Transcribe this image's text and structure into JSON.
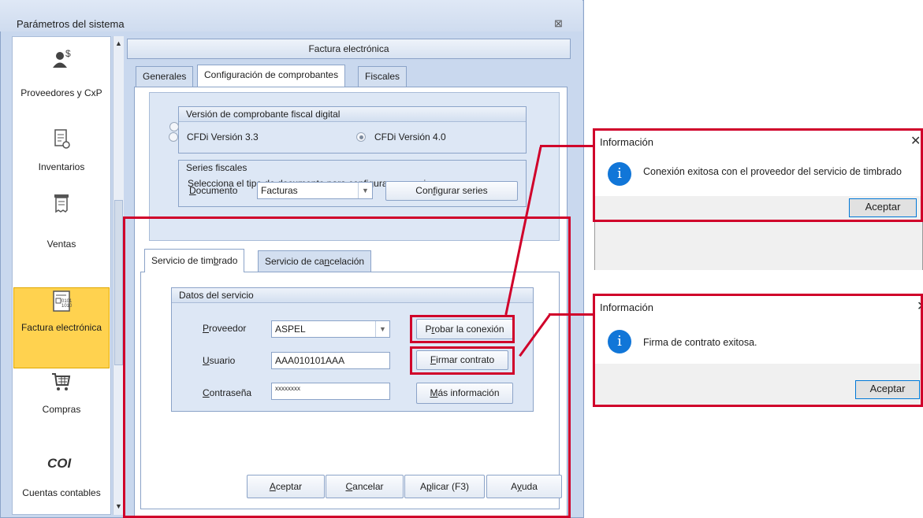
{
  "window": {
    "title": "Parámetros del sistema",
    "close_glyph": "⊠"
  },
  "nav": {
    "items": [
      {
        "label": "Proveedores y CxP",
        "icon": "supplier-money-icon"
      },
      {
        "label": "Inventarios",
        "icon": "inventory-icon"
      },
      {
        "label": "Ventas",
        "icon": "sales-icon"
      },
      {
        "label": "Factura electrónica",
        "icon": "invoice-icon",
        "selected": true
      },
      {
        "label": "Compras",
        "icon": "cart-icon"
      },
      {
        "label": "Cuentas contables",
        "icon": "coi-icon",
        "logo_text": "COI"
      }
    ]
  },
  "panel": {
    "header": "Factura electrónica",
    "tabs": [
      "Generales",
      "Configuración de comprobantes",
      "Fiscales"
    ],
    "active_tab": "Configuración de comprobantes",
    "version_group": {
      "title": "Versión de comprobante fiscal digital",
      "option1": "CFDi Versión 3.3",
      "option2": "CFDi Versión 4.0",
      "selected": "CFDi Versión 4.0"
    },
    "series_group": {
      "title": "Series fiscales",
      "instructions": "Selecciona el tipo de documento para configurar sus series",
      "doc_label_first": "D",
      "doc_label_rest": "ocumento",
      "doc_value": "Facturas",
      "config_button_a": "Con",
      "config_button_u": "f",
      "config_button_b": "igurar series"
    },
    "service_tabs": {
      "tab1_a": "Servicio de tim",
      "tab1_u": "b",
      "tab1_b": "rado",
      "tab2_a": "Servicio de ca",
      "tab2_u": "n",
      "tab2_b": "celación"
    },
    "service_data": {
      "title": "Datos del servicio",
      "provider_label_u": "P",
      "provider_label_rest": "roveedor",
      "provider_value": "ASPEL",
      "user_label_u": "U",
      "user_label_rest": "suario",
      "user_value": "AAA010101AAA",
      "password_label_u": "C",
      "password_label_rest": "ontraseña",
      "password_value": "xxxxxxxx",
      "test_btn_a": "P",
      "test_btn_u": "r",
      "test_btn_b": "obar la conexión",
      "sign_btn_u": "F",
      "sign_btn_b": "irmar contrato",
      "info_btn_u": "M",
      "info_btn_b": "ás información"
    },
    "footer_buttons": {
      "accept_u": "A",
      "accept_b": "ceptar",
      "cancel_u": "C",
      "cancel_b": "ancelar",
      "apply_a": "A",
      "apply_u": "p",
      "apply_b": "licar (F3)",
      "help_a": "A",
      "help_u": "y",
      "help_b": "uda"
    }
  },
  "dialog1": {
    "title": "Información",
    "message": "Conexión exitosa con el proveedor del servicio de timbrado",
    "button": "Aceptar"
  },
  "dialog2": {
    "title": "Información",
    "message": "Firma de contrato exitosa.",
    "button": "Aceptar"
  },
  "colors": {
    "highlight": "#d0002a",
    "selected_nav": "#ffd24f",
    "info_icon": "#1176d8"
  }
}
